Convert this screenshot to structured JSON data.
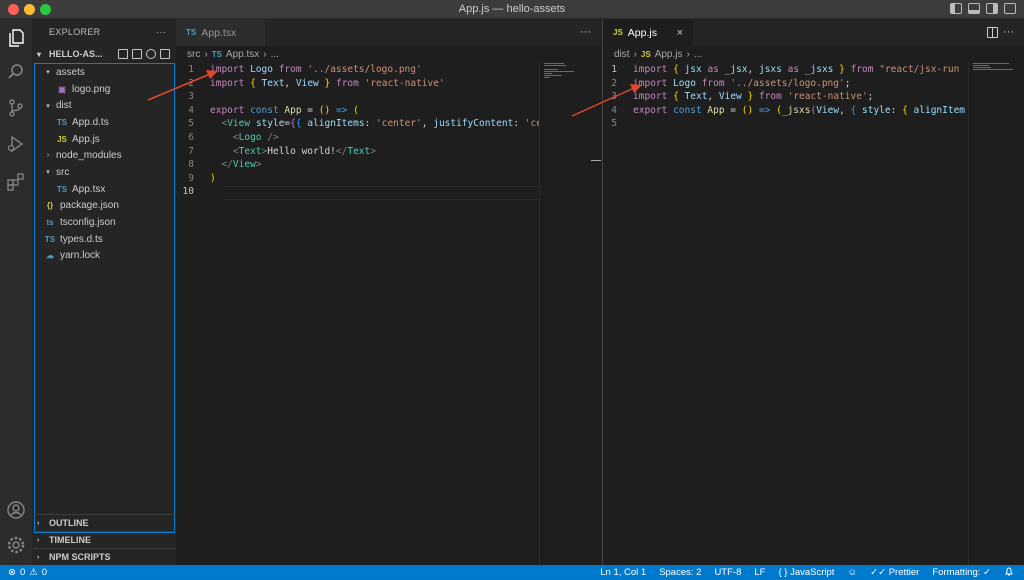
{
  "window": {
    "title": "App.js — hello-assets"
  },
  "sidebar": {
    "header": "EXPLORER",
    "more": "···",
    "root": "HELLO-AS...",
    "tree": [
      {
        "label": "assets",
        "type": "folder",
        "open": true,
        "depth": 0
      },
      {
        "label": "logo.png",
        "type": "image",
        "depth": 1
      },
      {
        "label": "dist",
        "type": "folder",
        "open": true,
        "depth": 0
      },
      {
        "label": "App.d.ts",
        "type": "ts",
        "depth": 1
      },
      {
        "label": "App.js",
        "type": "js",
        "depth": 1
      },
      {
        "label": "node_modules",
        "type": "folder",
        "open": false,
        "depth": 0
      },
      {
        "label": "src",
        "type": "folder",
        "open": true,
        "depth": 0
      },
      {
        "label": "App.tsx",
        "type": "ts",
        "depth": 1
      },
      {
        "label": "package.json",
        "type": "json",
        "depth": 0
      },
      {
        "label": "tsconfig.json",
        "type": "tsconfig",
        "depth": 0
      },
      {
        "label": "types.d.ts",
        "type": "ts",
        "depth": 0
      },
      {
        "label": "yarn.lock",
        "type": "yarn",
        "depth": 0
      }
    ],
    "sections": [
      "OUTLINE",
      "TIMELINE",
      "NPM SCRIPTS"
    ]
  },
  "editor_left": {
    "tab": {
      "badge": "TS",
      "label": "App.tsx"
    },
    "more": "···",
    "breadcrumb": [
      "src",
      "TS",
      "App.tsx",
      "..."
    ],
    "current_line": 10
  },
  "editor_right": {
    "tab": {
      "badge": "JS",
      "label": "App.js",
      "close": "×"
    },
    "breadcrumb": [
      "dist",
      "JS",
      "App.js",
      "..."
    ]
  },
  "statusbar": {
    "errors": "0",
    "warnings": "0",
    "position": "Ln 1, Col 1",
    "spaces": "Spaces: 2",
    "encoding": "UTF-8",
    "eol": "LF",
    "language": "JavaScript",
    "prettier": "Prettier",
    "formatting": "Formatting:"
  },
  "colors": {
    "accent": "#007acc",
    "arrow": "#e2472b",
    "keyword": "#c586c0",
    "string": "#ce9178",
    "variable": "#9cdcfe"
  },
  "icons": [
    "files-icon",
    "search-icon",
    "source-control-icon",
    "run-debug-icon",
    "extensions-icon",
    "account-icon",
    "settings-gear-icon"
  ]
}
